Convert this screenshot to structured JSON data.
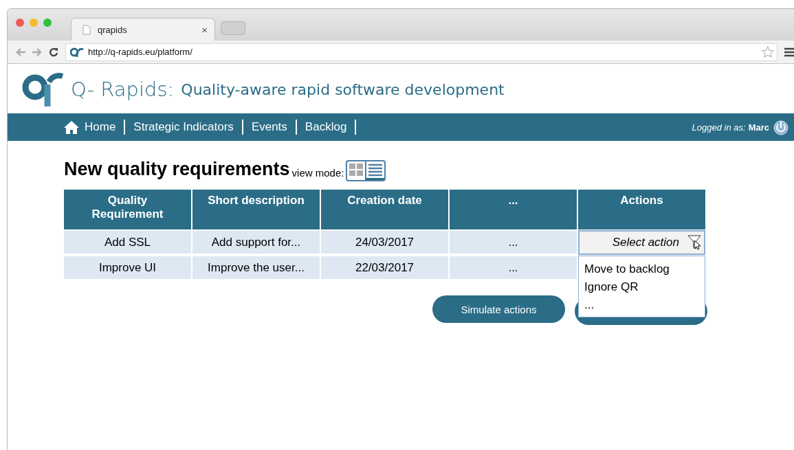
{
  "browser": {
    "tab": {
      "title": "qrapids",
      "close": "×"
    },
    "url": "http://q-rapids.eu/platform/"
  },
  "header": {
    "title": "Q- Rapids:",
    "subtitle": "Quality-aware rapid software development"
  },
  "nav": {
    "items": [
      {
        "label": "Home",
        "kind": "home"
      },
      {
        "label": "Strategic Indicators",
        "kind": "link"
      },
      {
        "label": "Events",
        "kind": "link"
      },
      {
        "label": "Backlog",
        "kind": "link"
      }
    ],
    "login_label": "Logged in as:",
    "user": "Marc"
  },
  "page": {
    "heading": "New quality requirements",
    "view_mode_label": "view mode:",
    "view_modes": [
      {
        "kind": "grid",
        "selected": false
      },
      {
        "kind": "list",
        "selected": true
      }
    ]
  },
  "table": {
    "columns": [
      "Quality Requirement",
      "Short description",
      "Creation date",
      "...",
      "Actions"
    ],
    "rows": [
      {
        "cells": [
          "Add SSL",
          "Add support for...",
          "24/03/2017",
          "..."
        ]
      },
      {
        "cells": [
          "Improve UI",
          "Improve the user...",
          "22/03/2017",
          "..."
        ]
      }
    ]
  },
  "action_select": {
    "value": "Select action",
    "expanded": true,
    "options": [
      "Move to backlog",
      "Ignore QR",
      "..."
    ]
  },
  "buttons": [
    {
      "kind": "labeled",
      "label": "Simulate actions"
    },
    {
      "kind": "covered"
    }
  ]
}
